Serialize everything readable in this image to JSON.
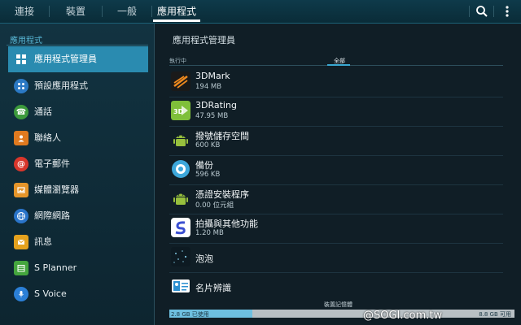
{
  "tabs": [
    {
      "label": "連接"
    },
    {
      "label": "裝置"
    },
    {
      "label": "一般"
    },
    {
      "label": "應用程式",
      "active": true
    }
  ],
  "topbar": {
    "search_icon": "search-icon",
    "more_icon": "more-vert-icon"
  },
  "sidebar": {
    "header": "應用程式",
    "items": [
      {
        "label": "應用程式管理員",
        "icon": "grid-icon",
        "color": "#2a8bb0",
        "active": true
      },
      {
        "label": "預設應用程式",
        "icon": "apps-icon",
        "color": "#2b79c4"
      },
      {
        "label": "通話",
        "icon": "phone-icon",
        "color": "#3c9a3c"
      },
      {
        "label": "聯絡人",
        "icon": "contact-icon",
        "color": "#e07a1f"
      },
      {
        "label": "電子郵件",
        "icon": "email-icon",
        "color": "#d9362b"
      },
      {
        "label": "媒體瀏覽器",
        "icon": "media-icon",
        "color": "#e5952a"
      },
      {
        "label": "網際網路",
        "icon": "globe-icon",
        "color": "#2a74c9"
      },
      {
        "label": "訊息",
        "icon": "message-icon",
        "color": "#e5a21e"
      },
      {
        "label": "S Planner",
        "icon": "calendar-icon",
        "color": "#45a53e"
      },
      {
        "label": "S Voice",
        "icon": "mic-icon",
        "color": "#2b7fd6"
      }
    ]
  },
  "main": {
    "title": "應用程式管理員",
    "filters": [
      {
        "label": "執行中"
      },
      {
        "label": "全部",
        "active": true
      }
    ],
    "apps": [
      {
        "name": "3DMark",
        "size": "194 MB",
        "icon": "3dmark-icon"
      },
      {
        "name": "3DRating",
        "size": "47.95 MB",
        "icon": "3drating-icon"
      },
      {
        "name": "撥號儲存空間",
        "size": "600 KB",
        "icon": "android-icon"
      },
      {
        "name": "備份",
        "size": "596 KB",
        "icon": "backup-icon"
      },
      {
        "name": "憑證安裝程序",
        "size": "0.00 位元組",
        "icon": "android-icon"
      },
      {
        "name": "拍攝與其他功能",
        "size": "1.20 MB",
        "icon": "shot-icon"
      },
      {
        "name": "泡泡",
        "size": "",
        "icon": "bubbles-icon"
      },
      {
        "name": "名片辨識",
        "size": "",
        "icon": "card-reader-icon"
      }
    ]
  },
  "storage": {
    "label": "裝置記憶體",
    "used": "2.8 GB 已使用",
    "free": "8.8 GB 可用",
    "used_fraction": 0.24
  },
  "watermark": "@SOGI.com.tw"
}
